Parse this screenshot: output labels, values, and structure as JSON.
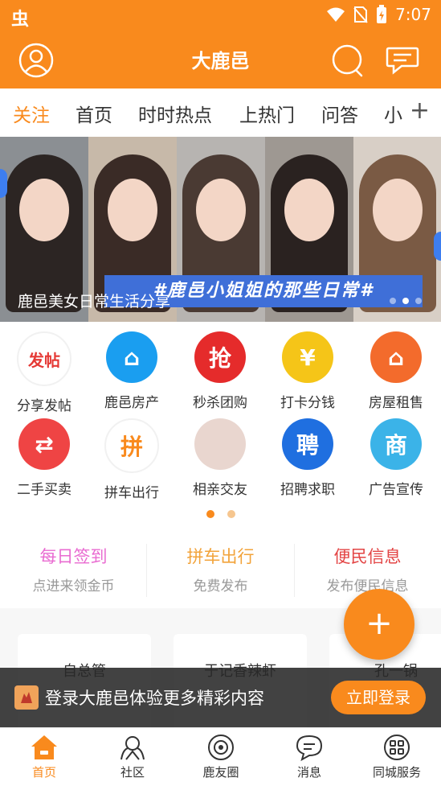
{
  "status_bar": {
    "app_glyph": "虫",
    "time": "7:07"
  },
  "app_bar": {
    "title": "大鹿邑"
  },
  "tabs": [
    {
      "label": "关注",
      "active": true
    },
    {
      "label": "首页"
    },
    {
      "label": "时时热点"
    },
    {
      "label": "上热门"
    },
    {
      "label": "问答"
    },
    {
      "label": "小"
    }
  ],
  "tabs_more": "+",
  "banner": {
    "strip_text": "#鹿邑小姐姐的那些日常#",
    "caption": "鹿邑美女日常生活分享"
  },
  "grid": [
    {
      "label": "分享发帖",
      "icon": "post-icon",
      "glyph": "发帖",
      "color": "#ffffff",
      "fg": "#e53935"
    },
    {
      "label": "鹿邑房产",
      "icon": "house-icon",
      "glyph": "⌂",
      "color": "#1a9ef0",
      "fg": "#ffffff"
    },
    {
      "label": "秒杀团购",
      "icon": "flash-sale-icon",
      "glyph": "抢",
      "color": "#e52b2b",
      "fg": "#ffffff"
    },
    {
      "label": "打卡分钱",
      "icon": "coins-icon",
      "glyph": "¥",
      "color": "#f5c518",
      "fg": "#ffffff"
    },
    {
      "label": "房屋租售",
      "icon": "house-rent-icon",
      "glyph": "⌂",
      "color": "#f36b2c",
      "fg": "#ffffff"
    },
    {
      "label": "二手买卖",
      "icon": "shopping-basket-icon",
      "glyph": "⇄",
      "color": "#ef4444",
      "fg": "#ffffff"
    },
    {
      "label": "拼车出行",
      "icon": "carpool-icon",
      "glyph": "拼",
      "color": "#ffffff",
      "fg": "#f98a1d"
    },
    {
      "label": "相亲交友",
      "icon": "dating-avatar-icon",
      "glyph": "",
      "color": "#e9d6cf",
      "fg": "#ffffff"
    },
    {
      "label": "招聘求职",
      "icon": "recruit-icon",
      "glyph": "聘",
      "color": "#1f6fe0",
      "fg": "#ffffff"
    },
    {
      "label": "广告宣传",
      "icon": "ad-icon",
      "glyph": "商",
      "color": "#3bb3e8",
      "fg": "#ffffff"
    }
  ],
  "quick": [
    {
      "title": "每日签到",
      "sub": "点进来领金币",
      "color": "#e96bd1"
    },
    {
      "title": "拼车出行",
      "sub": "免费发布",
      "color": "#f2a33a"
    },
    {
      "title": "便民信息",
      "sub": "发布便民信息",
      "color": "#e34545"
    }
  ],
  "cards": [
    {
      "title": "自总管"
    },
    {
      "title": "于记香辣虾"
    },
    {
      "title": "孔一锅"
    }
  ],
  "fab_label": "+",
  "login_bar": {
    "text": "登录大鹿邑体验更多精彩内容",
    "button": "立即登录"
  },
  "bottom_nav": [
    {
      "label": "首页",
      "icon": "home-icon",
      "active": true
    },
    {
      "label": "社区",
      "icon": "community-icon"
    },
    {
      "label": "鹿友圈",
      "icon": "circle-icon"
    },
    {
      "label": "消息",
      "icon": "message-icon"
    },
    {
      "label": "同城服务",
      "icon": "services-icon"
    }
  ],
  "colors": {
    "brand": "#f98a1d"
  }
}
